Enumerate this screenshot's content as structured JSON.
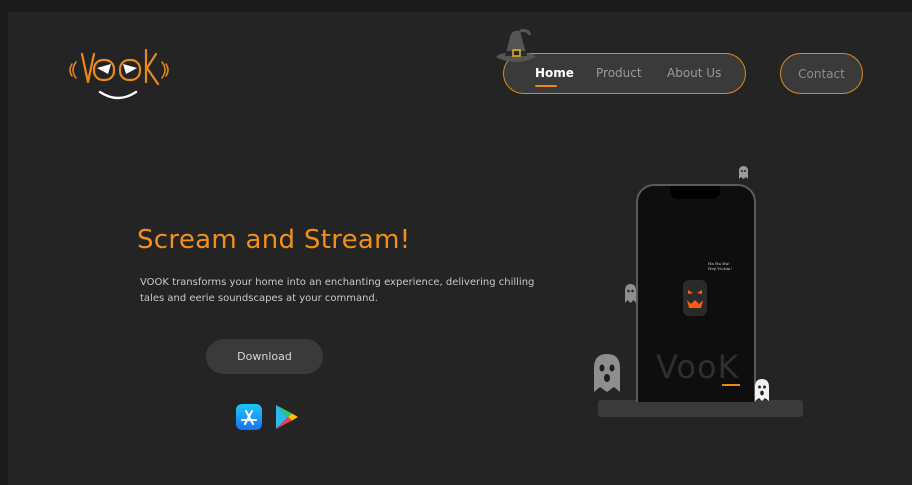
{
  "brand": {
    "logo_text": "VOOK"
  },
  "nav": {
    "items": [
      {
        "label": "Home",
        "active": true
      },
      {
        "label": "Product",
        "active": false
      },
      {
        "label": "About Us",
        "active": false
      }
    ],
    "contact_label": "Contact"
  },
  "hero": {
    "title": "Scream and Stream!",
    "description": "VOOK transforms your home into an enchanting experience, delivering chilling tales and eerie soundscapes at your command.",
    "download_label": "Download"
  },
  "phone": {
    "screen_logo": "VooK",
    "speech_line1": "Ha Ha Ha!",
    "speech_line2": "Hey Victim!"
  },
  "colors": {
    "accent": "#e8891a",
    "background": "#242424",
    "surface": "#3a3a3a"
  },
  "icons": [
    "witch-hat-icon",
    "app-store-icon",
    "google-play-icon",
    "ghost-icon",
    "pumpkin-icon"
  ]
}
